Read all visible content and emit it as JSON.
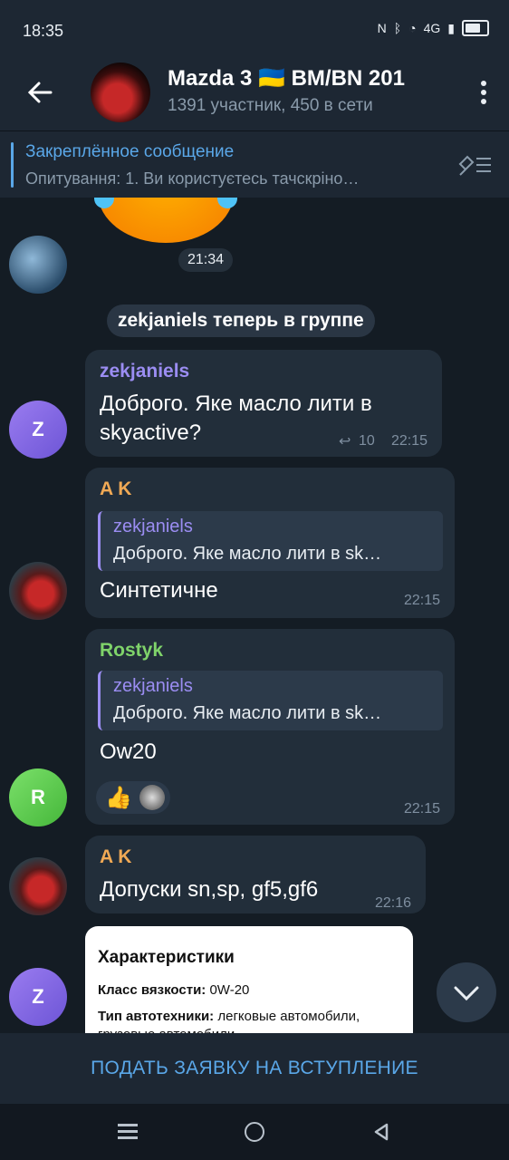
{
  "status_bar": {
    "time": "18:35",
    "network": "4G"
  },
  "header": {
    "title": "Mazda 3 🇺🇦 BM/BN 201",
    "subtitle": "1391 участник, 450 в сети"
  },
  "pinned": {
    "title": "Закреплённое сообщение",
    "text": "Опитування:  1. Ви користуєтесь тачскріно…"
  },
  "messages": {
    "sticker_time": "21:34",
    "service": "zekjaniels теперь в группе",
    "m1": {
      "name": "zekjaniels",
      "text_line1": "Доброго. Яке масло лити в",
      "text_line2": "skyactive?",
      "replies": "10",
      "time": "22:15",
      "avatar_letter": "Z"
    },
    "m2": {
      "name": "A K",
      "reply_name": "zekjaniels",
      "reply_text": "Доброго. Яке масло лити в sk…",
      "text": "Синтетичне",
      "time": "22:15"
    },
    "m3": {
      "name": "Rostyk",
      "reply_name": "zekjaniels",
      "reply_text": "Доброго. Яке масло лити в sk…",
      "text": "Ow20",
      "reaction": "👍",
      "time": "22:15",
      "avatar_letter": "R"
    },
    "m4": {
      "name": "A K",
      "text": "Допуски sn,sp, gf5,gf6",
      "time": "22:16"
    },
    "m5": {
      "avatar_letter": "Z",
      "card_title": "Характеристики",
      "line1_label": "Класс вязкости:",
      "line1_value": "0W-20",
      "line2_label": "Тип автотехники:",
      "line2_value": "легковые автомобили, грузовые автомобили"
    }
  },
  "join_button": "ПОДАТЬ ЗАЯВКУ НА ВСТУПЛЕНИЕ",
  "colors": {
    "accent": "#5aa7e8",
    "bg": "#141c24",
    "bubble": "#222e3a"
  }
}
